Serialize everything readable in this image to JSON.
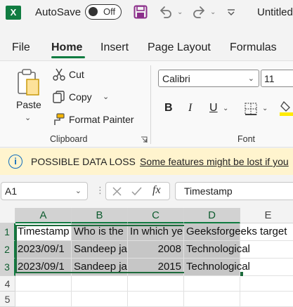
{
  "titlebar": {
    "app_logo": "X",
    "autosave_label": "AutoSave",
    "autosave_state": "Off",
    "title": "Untitled"
  },
  "tabs": [
    "File",
    "Home",
    "Insert",
    "Page Layout",
    "Formulas"
  ],
  "active_tab": "Home",
  "clipboard": {
    "paste": "Paste",
    "cut": "Cut",
    "copy": "Copy",
    "format_painter": "Format Painter",
    "group_label": "Clipboard"
  },
  "font": {
    "name": "Calibri",
    "size": "11",
    "group_label": "Font",
    "bold": "B",
    "italic": "I",
    "underline": "U"
  },
  "infobar": {
    "title": "POSSIBLE DATA LOSS",
    "message": "Some features might be lost if you"
  },
  "formula_bar": {
    "name_box": "A1",
    "fx": "fx",
    "content": "Timestamp"
  },
  "colors": {
    "excel_green": "#107c41",
    "selection_fill": "#c6c6c6",
    "info_bg": "#fff4ce"
  },
  "grid": {
    "columns": [
      "A",
      "B",
      "C",
      "D",
      "E"
    ],
    "rows": [
      "1",
      "2",
      "3",
      "4",
      "5"
    ],
    "cells": [
      [
        "Timestamp",
        "Who is the",
        "In which ye",
        "Geeksforgeeks target",
        ""
      ],
      [
        "2023/09/1",
        "Sandeep ja",
        "2008",
        "Technological",
        ""
      ],
      [
        "2023/09/1",
        "Sandeep ja",
        "2015",
        "Technological",
        ""
      ]
    ]
  }
}
